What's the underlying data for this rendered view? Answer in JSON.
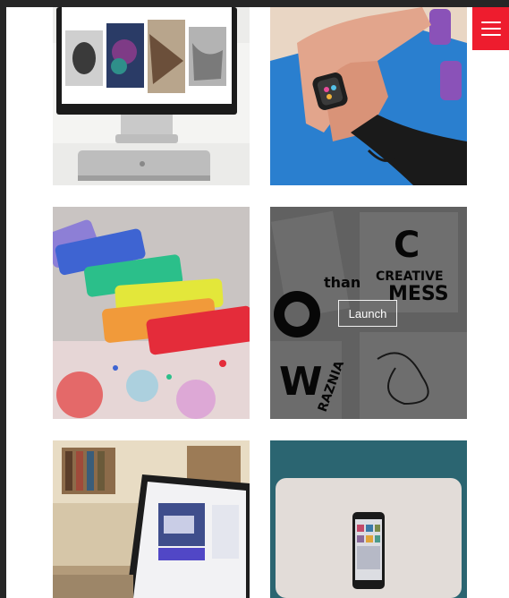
{
  "menu": {
    "icon": "hamburger-menu-icon",
    "color": "#ee1c2e"
  },
  "portfolio": {
    "items": [
      {
        "subject": "desktop-computer-gallery",
        "hover": false
      },
      {
        "subject": "smartwatch-on-wrist",
        "hover": false
      },
      {
        "subject": "colorful-chalks",
        "hover": false
      },
      {
        "subject": "creative-mess-posters",
        "hover": true,
        "action_label": "Launch"
      },
      {
        "subject": "laptop-on-desk",
        "hover": false
      },
      {
        "subject": "phone-on-laptop",
        "hover": false
      }
    ]
  }
}
